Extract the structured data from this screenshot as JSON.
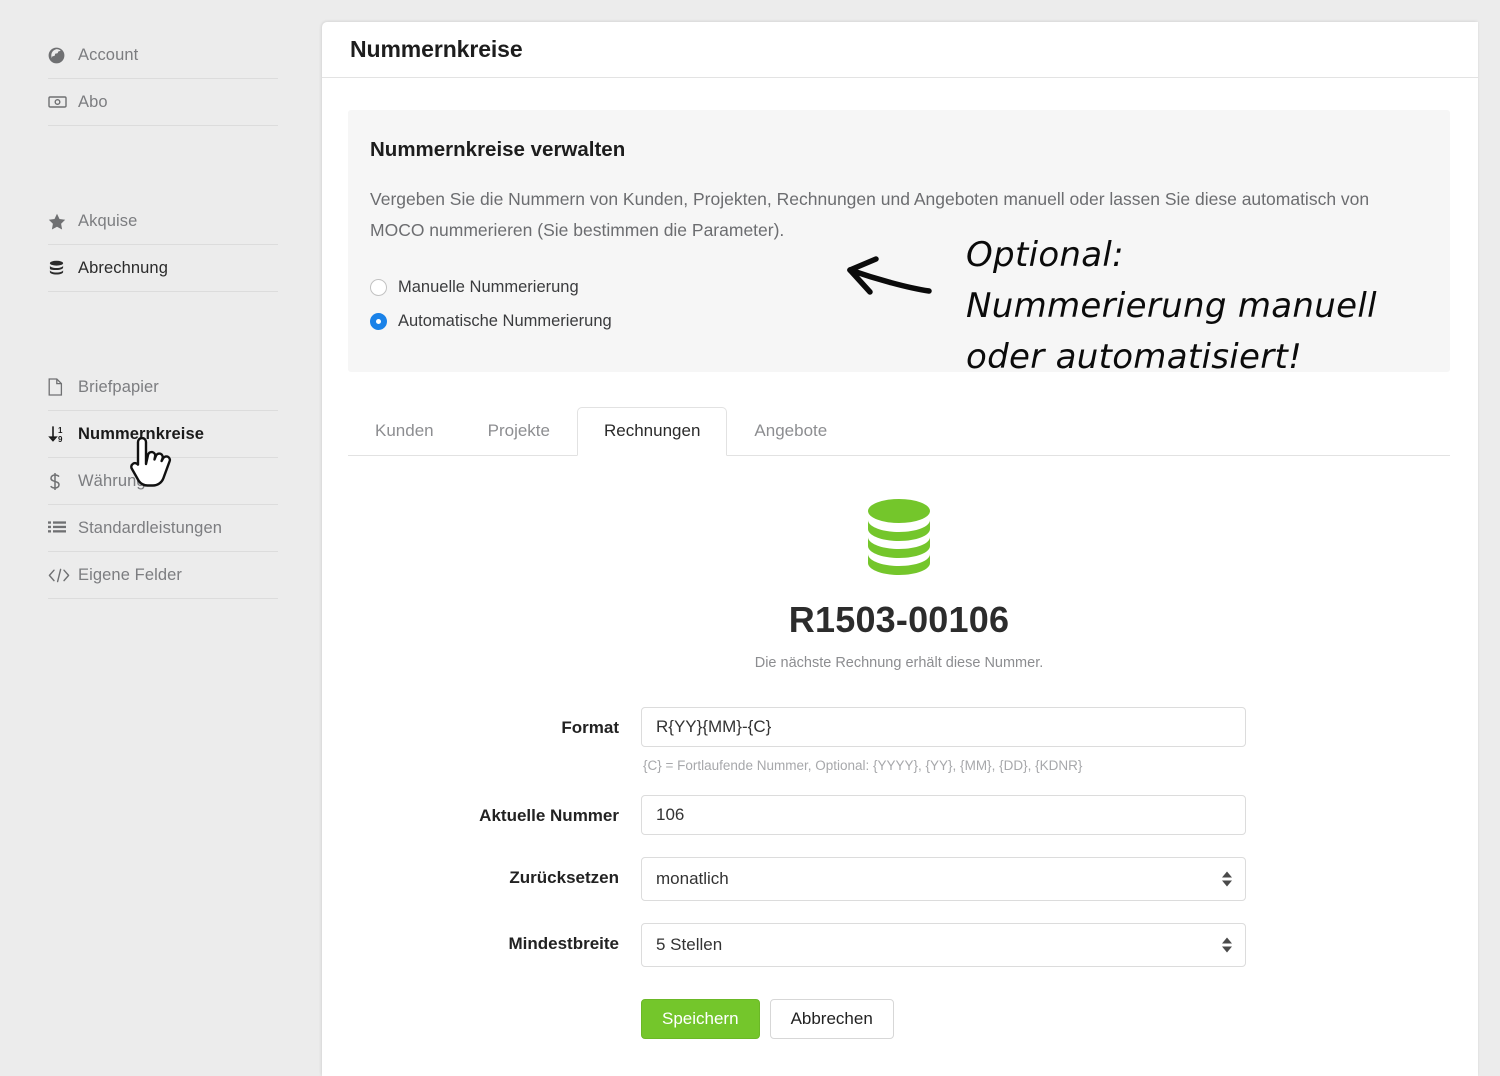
{
  "sidebar": {
    "groups": [
      {
        "items": [
          {
            "label": "Account",
            "icon": "globe-icon",
            "state": "normal"
          },
          {
            "label": "Abo",
            "icon": "banknote-icon",
            "state": "normal"
          }
        ]
      },
      {
        "items": [
          {
            "label": "Akquise",
            "icon": "star-icon",
            "state": "normal"
          },
          {
            "label": "Abrechnung",
            "icon": "database-icon",
            "state": "dark"
          }
        ]
      },
      {
        "items": [
          {
            "label": "Briefpapier",
            "icon": "file-icon",
            "state": "normal"
          },
          {
            "label": "Nummernkreise",
            "icon": "sort-numeric-icon",
            "state": "current"
          },
          {
            "label": "Währung",
            "icon": "dollar-icon",
            "state": "normal"
          },
          {
            "label": "Standardleistungen",
            "icon": "list-icon",
            "state": "normal"
          },
          {
            "label": "Eigene Felder",
            "icon": "code-icon",
            "state": "normal"
          }
        ]
      }
    ]
  },
  "header": {
    "title": "Nummernkreise"
  },
  "infobox": {
    "title": "Nummernkreise verwalten",
    "description": "Vergeben Sie die Nummern von Kunden, Projekten, Rechnungen und Angeboten manuell oder lassen Sie diese automatisch von MOCO nummerieren (Sie bestimmen die Parameter).",
    "options": [
      {
        "label": "Manuelle Nummerierung",
        "selected": false
      },
      {
        "label": "Automatische Nummerierung",
        "selected": true
      }
    ]
  },
  "annotation": {
    "line1": "Optional:",
    "line2": "Nummerierung manuell",
    "line3": "oder automatisiert!",
    "arrow": "left-arrow-icon"
  },
  "tabs": [
    {
      "label": "Kunden",
      "active": false
    },
    {
      "label": "Projekte",
      "active": false
    },
    {
      "label": "Rechnungen",
      "active": true
    },
    {
      "label": "Angebote",
      "active": false
    }
  ],
  "preview": {
    "icon": "database-icon",
    "icon_color": "#74c62b",
    "number": "R1503-00106",
    "note": "Die nächste Rechnung erhält diese Nummer."
  },
  "form": {
    "fields": [
      {
        "label": "Format",
        "type": "text",
        "value": "R{YY}{MM}-{C}",
        "hint": "{C} = Fortlaufende Nummer, Optional: {YYYY}, {YY}, {MM}, {DD}, {KDNR}"
      },
      {
        "label": "Aktuelle Nummer",
        "type": "text",
        "value": "106",
        "hint": ""
      },
      {
        "label": "Zurücksetzen",
        "type": "select",
        "value": "monatlich",
        "hint": ""
      },
      {
        "label": "Mindestbreite",
        "type": "select",
        "value": "5 Stellen",
        "hint": ""
      }
    ],
    "save_label": "Speichern",
    "cancel_label": "Abbrechen"
  },
  "colors": {
    "accent_green": "#74c62b",
    "radio_blue": "#1a82e8",
    "page_bg": "#ececec",
    "panel_bg": "#ffffff",
    "infobox_bg": "#f6f6f6"
  }
}
